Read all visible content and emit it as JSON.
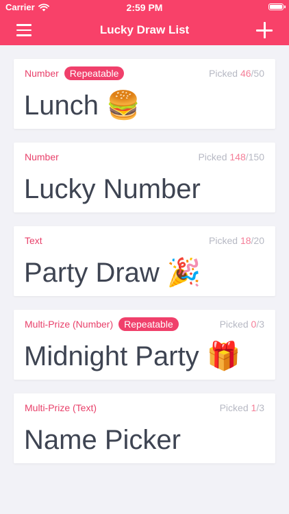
{
  "status_bar": {
    "carrier": "Carrier",
    "time": "2:59 PM"
  },
  "nav": {
    "title": "Lucky Draw List",
    "menu_icon": "hamburger-menu-icon",
    "add_icon": "plus-icon"
  },
  "colors": {
    "accent": "#f84169",
    "badge": "#f0406b",
    "picked_count": "#f47d97",
    "title_text": "#3e4452",
    "muted": "#b6b8c3",
    "background": "#f2f2f7"
  },
  "draws": [
    {
      "type": "Number",
      "badge": "Repeatable",
      "picked_prefix": "Picked ",
      "picked": "46",
      "total": "/50",
      "title": "Lunch 🍔"
    },
    {
      "type": "Number",
      "badge": "",
      "picked_prefix": "Picked ",
      "picked": "148",
      "total": "/150",
      "title": "Lucky Number"
    },
    {
      "type": "Text",
      "badge": "",
      "picked_prefix": "Picked ",
      "picked": "18",
      "total": "/20",
      "title": "Party Draw 🎉"
    },
    {
      "type": "Multi-Prize (Number)",
      "badge": "Repeatable",
      "picked_prefix": "Picked ",
      "picked": "0",
      "total": "/3",
      "title": "Midnight Party 🎁"
    },
    {
      "type": "Multi-Prize (Text)",
      "badge": "",
      "picked_prefix": "Picked ",
      "picked": "1",
      "total": "/3",
      "title": "Name Picker"
    }
  ]
}
